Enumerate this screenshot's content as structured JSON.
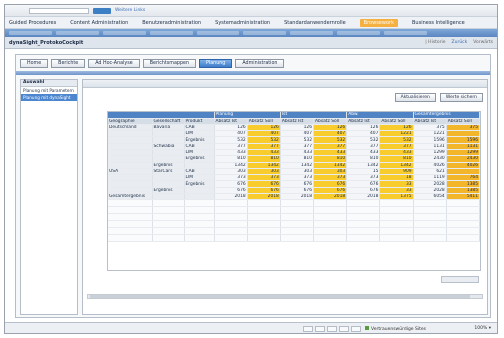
{
  "browser": {
    "link": "Weitere Links"
  },
  "app_menu": [
    {
      "label": "Guided Procedures",
      "active": false
    },
    {
      "label": "Content Administration",
      "active": false
    },
    {
      "label": "Benutzeradministration",
      "active": false
    },
    {
      "label": "Systemadministration",
      "active": false
    },
    {
      "label": "Standardanwendernrolle",
      "active": false
    },
    {
      "label": "Browsework",
      "active": true
    },
    {
      "label": "Business Intelligence",
      "active": false
    }
  ],
  "page_title": "dynaSight_ProtokoCockpit",
  "title_right": {
    "history": "| Historie",
    "back": "Zurück",
    "forward": "Vorwärts"
  },
  "tabs": [
    {
      "label": "Home",
      "active": false
    },
    {
      "label": "Berichte",
      "active": false
    },
    {
      "label": "Ad Hoc-Analyse",
      "active": false
    },
    {
      "label": "Berichtsmappen",
      "active": false
    },
    {
      "label": "Planung",
      "active": true
    },
    {
      "label": "Administration",
      "active": false
    }
  ],
  "left_panel": {
    "header": "Auswahl",
    "items": [
      {
        "label": "Planung mit Parametern",
        "selected": false
      },
      {
        "label": "Planung mit dynaSight",
        "selected": true
      }
    ]
  },
  "actions": {
    "refresh": "Aktualisieren",
    "save": "Werte sichern"
  },
  "table": {
    "header1": [
      "Planung",
      "Ist",
      "Abw.",
      "Gesamtergebnis"
    ],
    "header2": [
      "Geographie",
      "Gesellschaft",
      "Produkt",
      "Absatz Ist",
      "Absatz Soll",
      "Absatz Ist",
      "Absatz Soll",
      "Absatz Ist",
      "Absatz Soll",
      "Absatz Ist",
      "Absatz Soll",
      "Absatz Ist",
      "Absatz Soll"
    ],
    "rows": [
      [
        "Deutschland",
        "Bavaria",
        "CAB",
        "126",
        "126",
        "126",
        "126",
        "126",
        "126",
        "375",
        "375"
      ],
      [
        "",
        "",
        "LIM",
        "407",
        "407",
        "407",
        "407",
        "407",
        "1221",
        "1221",
        ""
      ],
      [
        "",
        "",
        "Ergebnis",
        "532",
        "532",
        "532",
        "532",
        "532",
        "532",
        "1596",
        "1596"
      ],
      [
        "",
        "Schwabia",
        "CAB",
        "377",
        "377",
        "377",
        "377",
        "377",
        "377",
        "1131",
        "1131"
      ],
      [
        "",
        "",
        "LIM",
        "433",
        "433",
        "433",
        "433",
        "433",
        "433",
        "1299",
        "1299"
      ],
      [
        "",
        "",
        "Ergebnis",
        "810",
        "810",
        "810",
        "810",
        "810",
        "810",
        "2430",
        "2430"
      ],
      [
        "",
        "Ergebnis",
        "",
        "1342",
        "1342",
        "1342",
        "1342",
        "1342",
        "1342",
        "4026",
        "4026"
      ],
      [
        "USA",
        "StarCars",
        "CAB",
        "303",
        "303",
        "303",
        "303",
        "15",
        "909",
        "621",
        ""
      ],
      [
        "",
        "",
        "LIM",
        "373",
        "373",
        "373",
        "373",
        "373",
        "18",
        "1119",
        "764"
      ],
      [
        "",
        "",
        "Ergebnis",
        "676",
        "676",
        "676",
        "676",
        "676",
        "33",
        "2028",
        "1385"
      ],
      [
        "",
        "Ergebnis",
        "",
        "676",
        "676",
        "676",
        "676",
        "676",
        "33",
        "2028",
        "1385"
      ],
      [
        "Gesamtergebnis",
        "",
        "",
        "2018",
        "2018",
        "2018",
        "2018",
        "2018",
        "1375",
        "6054",
        "5411"
      ]
    ]
  },
  "status": {
    "zone": "Vertrauenswürdige Sites",
    "zoom": "100%"
  },
  "colors": {
    "accent": "#4f83c4",
    "highlight": "#f9cc2e",
    "active_menu": "#f4b040"
  }
}
